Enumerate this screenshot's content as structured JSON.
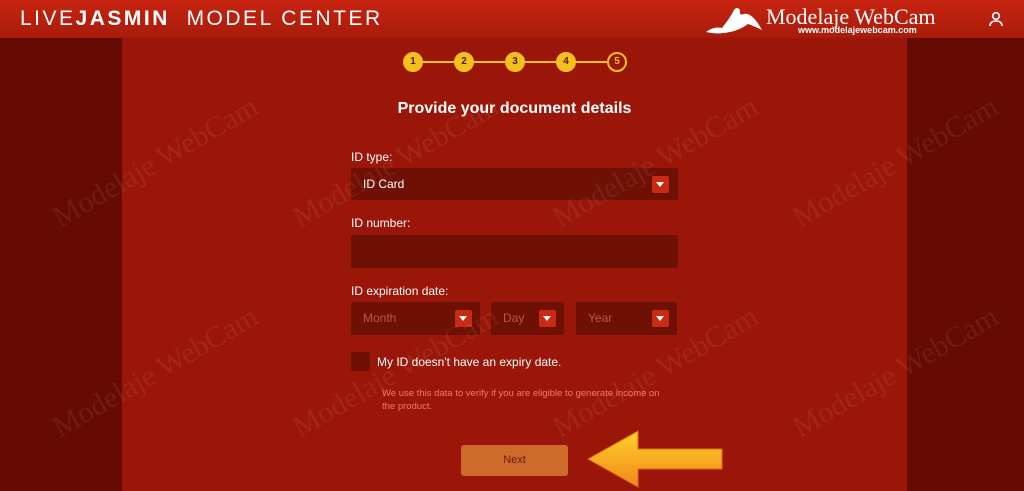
{
  "header": {
    "brand_live": "LIVE",
    "brand_jasmin": "JASMIN",
    "brand_center": "MODEL CENTER",
    "watermark_title": "Modelaje WebCam",
    "watermark_url": "www.modelajewebcam.com"
  },
  "steps": [
    "1",
    "2",
    "3",
    "4",
    "5"
  ],
  "current_step": 5,
  "form": {
    "title": "Provide your document details",
    "id_type_label": "ID type:",
    "id_type_value": "ID Card",
    "id_number_label": "ID number:",
    "id_number_value": "",
    "expiration_label": "ID expiration date:",
    "month_placeholder": "Month",
    "day_placeholder": "Day",
    "year_placeholder": "Year",
    "no_expiry_label": "My ID doesn't have an expiry date.",
    "no_expiry_checked": false,
    "note_line1": "We use this data to verify if you are eligible to generate income on",
    "note_line2": "the product.",
    "next_label": "Next"
  },
  "colors": {
    "header": "#b81f0c",
    "panel": "#9a1608",
    "sides": "#650b04",
    "accent": "#f3c020",
    "field": "#6e1004",
    "arrow": "#f7a21a"
  }
}
